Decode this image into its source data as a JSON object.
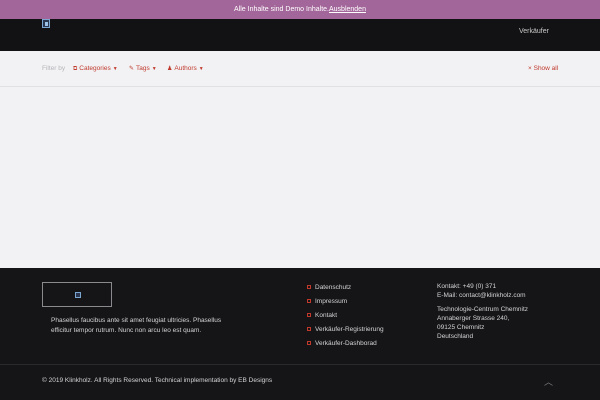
{
  "demo_bar": {
    "text": "Alle Inhalte sind Demo Inhalte.",
    "link": "Ausblenden"
  },
  "header": {
    "nav": [
      "Verkäufer"
    ]
  },
  "filter_bar": {
    "label": "Filter by",
    "filters": [
      {
        "icon": "categories-icon",
        "label": "Categories"
      },
      {
        "icon": "tags-icon",
        "label": "Tags"
      },
      {
        "icon": "authors-icon",
        "label": "Authors"
      }
    ],
    "show_all": "Show all"
  },
  "footer": {
    "description": "Phasellus faucibus ante sit amet feugiat ultricies. Phasellus efficitur tempor rutrum. Nunc non arcu leo est quam.",
    "links": [
      "Datenschutz",
      "Impressum",
      "Kontakt",
      "Verkäufer-Registrierung",
      "Verkäufer-Dashborad"
    ],
    "contact": {
      "phone": "Kontakt: +49 (0) 371",
      "email": "E-Mail: contact@klinkholz.com",
      "address_1": "Technologie-Centrum Chemnitz",
      "address_2": "Annaberger Strasse 240,",
      "address_3": "09125 Chemnitz",
      "address_4": "Deutschland"
    },
    "copyright": "© 2019 Klinkholz. All Rights Reserved. Technical implementation by EB Designs"
  },
  "colors": {
    "accent": "#c0392b",
    "demo_bar": "#a3669a",
    "dark": "#121214"
  }
}
